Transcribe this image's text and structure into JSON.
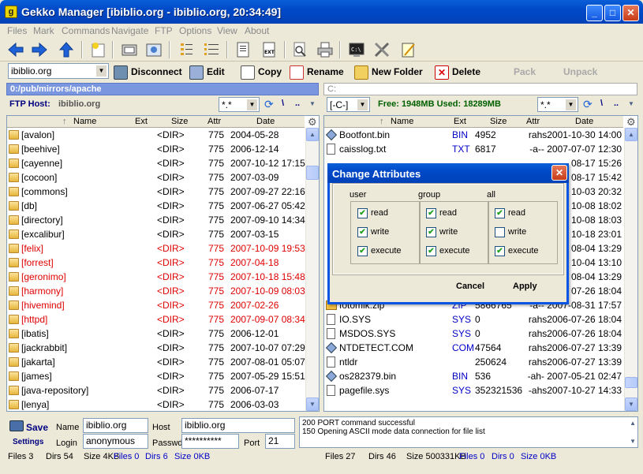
{
  "window": {
    "title": "Gekko Manager [ibiblio.org - ibiblio.org, 20:34:49]"
  },
  "menu": [
    "Files",
    "Mark",
    "Commands",
    "Navigate",
    "FTP",
    "Options",
    "View",
    "About"
  ],
  "actions": {
    "site_combo": "ibiblio.org",
    "disconnect": "Disconnect",
    "edit": "Edit",
    "copy": "Copy",
    "rename": "Rename",
    "new_folder": "New Folder",
    "delete": "Delete",
    "pack": "Pack",
    "unpack": "Unpack"
  },
  "left": {
    "path": "0:/pub/mirrors/apache",
    "host_label": "FTP Host:",
    "host_value": "ibiblio.org",
    "filter": "*.*",
    "nav1": "\\",
    "nav2": "..",
    "columns": {
      "name": "Name",
      "ext": "Ext",
      "size": "Size",
      "attr": "Attr",
      "date": "Date"
    },
    "rows": [
      {
        "name": "[avalon]",
        "size": "<DIR>",
        "attr": "775",
        "date": "2004-05-28",
        "red": false
      },
      {
        "name": "[beehive]",
        "size": "<DIR>",
        "attr": "775",
        "date": "2006-12-14",
        "red": false
      },
      {
        "name": "[cayenne]",
        "size": "<DIR>",
        "attr": "775",
        "date": "2007-10-12 17:15",
        "red": false
      },
      {
        "name": "[cocoon]",
        "size": "<DIR>",
        "attr": "775",
        "date": "2007-03-09",
        "red": false
      },
      {
        "name": "[commons]",
        "size": "<DIR>",
        "attr": "775",
        "date": "2007-09-27 22:16",
        "red": false
      },
      {
        "name": "[db]",
        "size": "<DIR>",
        "attr": "775",
        "date": "2007-06-27 05:42",
        "red": false
      },
      {
        "name": "[directory]",
        "size": "<DIR>",
        "attr": "775",
        "date": "2007-09-10 14:34",
        "red": false
      },
      {
        "name": "[excalibur]",
        "size": "<DIR>",
        "attr": "775",
        "date": "2007-03-15",
        "red": false
      },
      {
        "name": "[felix]",
        "size": "<DIR>",
        "attr": "775",
        "date": "2007-10-09 19:53",
        "red": true
      },
      {
        "name": "[forrest]",
        "size": "<DIR>",
        "attr": "775",
        "date": "2007-04-18",
        "red": true
      },
      {
        "name": "[geronimo]",
        "size": "<DIR>",
        "attr": "775",
        "date": "2007-10-18 15:48",
        "red": true
      },
      {
        "name": "[harmony]",
        "size": "<DIR>",
        "attr": "775",
        "date": "2007-10-09 08:03",
        "red": true
      },
      {
        "name": "[hivemind]",
        "size": "<DIR>",
        "attr": "775",
        "date": "2007-02-26",
        "red": true
      },
      {
        "name": "[httpd]",
        "size": "<DIR>",
        "attr": "775",
        "date": "2007-09-07 08:34",
        "red": true
      },
      {
        "name": "[ibatis]",
        "size": "<DIR>",
        "attr": "775",
        "date": "2006-12-01",
        "red": false
      },
      {
        "name": "[jackrabbit]",
        "size": "<DIR>",
        "attr": "775",
        "date": "2007-10-07 07:29",
        "red": false
      },
      {
        "name": "[jakarta]",
        "size": "<DIR>",
        "attr": "775",
        "date": "2007-08-01 05:07",
        "red": false
      },
      {
        "name": "[james]",
        "size": "<DIR>",
        "attr": "775",
        "date": "2007-05-29 15:51",
        "red": false
      },
      {
        "name": "[java-repository]",
        "size": "<DIR>",
        "attr": "775",
        "date": "2006-07-17",
        "red": false
      },
      {
        "name": "[lenya]",
        "size": "<DIR>",
        "attr": "775",
        "date": "2006-03-03",
        "red": false
      }
    ],
    "status": {
      "files": "Files 3",
      "dirs": "Dirs 54",
      "size": "Size 4KB",
      "sel_files": "Files 0",
      "sel_dirs": "Dirs 6",
      "sel_size": "Size 0KB"
    }
  },
  "right": {
    "path": "C:",
    "drive": "[-C-]",
    "free_info": "Free: 1948MB Used: 18289MB",
    "filter": "*.*",
    "nav1": "\\",
    "nav2": "..",
    "columns": {
      "name": "Name",
      "ext": "Ext",
      "size": "Size",
      "attr": "Attr",
      "date": "Date"
    },
    "rows": [
      {
        "name": "Bootfont.bin",
        "ext": "BIN",
        "size": "4952",
        "attrdate": "rahs2001-10-30 14:00",
        "icon": "diamond"
      },
      {
        "name": "caisslog.txt",
        "ext": "TXT",
        "size": "6817",
        "attrdate": "-a-- 2007-07-07 12:30",
        "icon": "doc"
      },
      {
        "name": "",
        "ext": "",
        "size": "",
        "attrdate": "08-17 15:26",
        "icon": ""
      },
      {
        "name": "",
        "ext": "",
        "size": "",
        "attrdate": "08-17 15:42",
        "icon": ""
      },
      {
        "name": "",
        "ext": "",
        "size": "",
        "attrdate": "10-03 20:32",
        "icon": ""
      },
      {
        "name": "",
        "ext": "",
        "size": "",
        "attrdate": "10-08 18:02",
        "icon": ""
      },
      {
        "name": "",
        "ext": "",
        "size": "",
        "attrdate": "10-08 18:03",
        "icon": ""
      },
      {
        "name": "",
        "ext": "",
        "size": "",
        "attrdate": "10-18 23:01",
        "icon": ""
      },
      {
        "name": "",
        "ext": "",
        "size": "",
        "attrdate": "08-04 13:29",
        "icon": ""
      },
      {
        "name": "",
        "ext": "",
        "size": "",
        "attrdate": "10-04 13:10",
        "icon": ""
      },
      {
        "name": "",
        "ext": "",
        "size": "",
        "attrdate": "08-04 13:29",
        "icon": ""
      },
      {
        "name": "",
        "ext": "",
        "size": "",
        "attrdate": "07-26 18:04",
        "icon": ""
      },
      {
        "name": "fotomik.zip",
        "ext": "ZIP",
        "size": "5866765",
        "attrdate": "-a-- 2007-08-31 17:57",
        "icon": "zip"
      },
      {
        "name": "IO.SYS",
        "ext": "SYS",
        "size": "0",
        "attrdate": "rahs2006-07-26 18:04",
        "icon": "doc"
      },
      {
        "name": "MSDOS.SYS",
        "ext": "SYS",
        "size": "0",
        "attrdate": "rahs2006-07-26 18:04",
        "icon": "doc"
      },
      {
        "name": "NTDETECT.COM",
        "ext": "COM",
        "size": "47564",
        "attrdate": "rahs2006-07-27 13:39",
        "icon": "diamond"
      },
      {
        "name": "ntldr",
        "ext": "",
        "size": "250624",
        "attrdate": "rahs2006-07-27 13:39",
        "icon": "doc"
      },
      {
        "name": "os282379.bin",
        "ext": "BIN",
        "size": "536",
        "attrdate": "-ah- 2007-05-21 02:47",
        "icon": "diamond"
      },
      {
        "name": "pagefile.sys",
        "ext": "SYS",
        "size": "352321536",
        "attrdate": "-ahs2007-10-27 14:33",
        "icon": "doc"
      }
    ],
    "status": {
      "files": "Files 27",
      "dirs": "Dirs 46",
      "size": "Size 500331KB",
      "sel_files": "Files 0",
      "sel_dirs": "Dirs 0",
      "sel_size": "Size 0KB"
    }
  },
  "settings": {
    "save": "Save",
    "settings": "Settings",
    "name_label": "Name",
    "name_value": "ibiblio.org",
    "host_label": "Host",
    "host_value": "ibiblio.org",
    "login_label": "Login",
    "login_value": "anonymous",
    "passwd_label": "Passwd",
    "passwd_value": "**********",
    "port_label": "Port",
    "port_value": "21"
  },
  "log": [
    "200 PORT command successful",
    "150 Opening ASCII mode data connection for file list"
  ],
  "dialog": {
    "title": "Change Attributes",
    "groups": [
      {
        "label": "user",
        "items": [
          {
            "label": "read",
            "checked": true
          },
          {
            "label": "write",
            "checked": true
          },
          {
            "label": "execute",
            "checked": true
          }
        ]
      },
      {
        "label": "group",
        "items": [
          {
            "label": "read",
            "checked": true
          },
          {
            "label": "write",
            "checked": true
          },
          {
            "label": "execute",
            "checked": true
          }
        ]
      },
      {
        "label": "all",
        "items": [
          {
            "label": "read",
            "checked": true
          },
          {
            "label": "write",
            "checked": false
          },
          {
            "label": "execute",
            "checked": true
          }
        ]
      }
    ],
    "cancel": "Cancel",
    "apply": "Apply"
  }
}
